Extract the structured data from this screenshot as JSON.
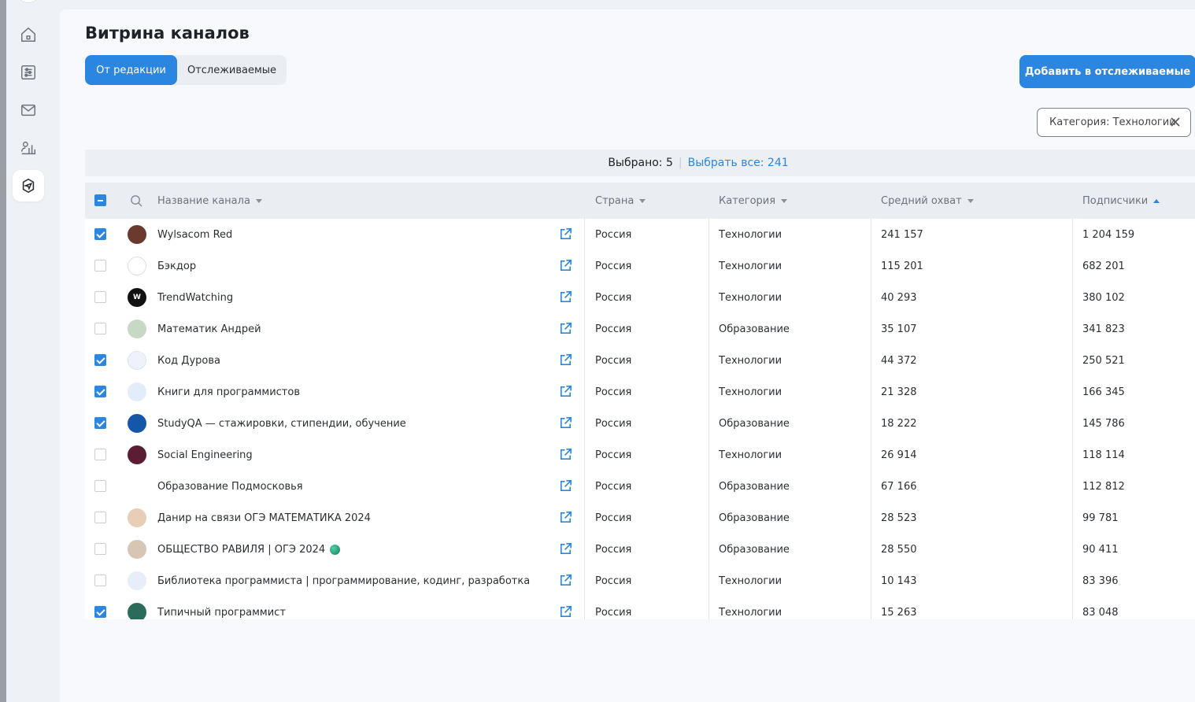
{
  "page": {
    "title": "Витрина каналов"
  },
  "tabs": [
    {
      "label": "От редакции",
      "active": true
    },
    {
      "label": "Отслеживаемые",
      "active": false
    }
  ],
  "actions": {
    "add_label": "Добавить в отслеживаемые"
  },
  "filter": {
    "label": "Категория: Технологии"
  },
  "selection": {
    "selected_text": "Выбрано: 5",
    "select_all_text": "Выбрать все: 241"
  },
  "nav": [
    "home-icon",
    "sliders-icon",
    "mail-icon",
    "analytics-icon",
    "channels-icon"
  ],
  "colors": {
    "accent": "#2a86e0",
    "background": "#f7f9fc"
  },
  "table": {
    "columns": [
      {
        "label": "Название канала",
        "sort": "down"
      },
      {
        "label": "Страна",
        "sort": "down"
      },
      {
        "label": "Категория",
        "sort": "down"
      },
      {
        "label": "Средний охват",
        "sort": "down"
      },
      {
        "label": "Подписчики",
        "sort": "up"
      }
    ],
    "rows": [
      {
        "checked": true,
        "name": "Wylsacom Red",
        "country": "Россия",
        "category": "Технологии",
        "reach": "241 157",
        "subscribers": "1 204 159"
      },
      {
        "checked": false,
        "name": "Бэкдор",
        "country": "Россия",
        "category": "Технологии",
        "reach": "115 201",
        "subscribers": "682 201"
      },
      {
        "checked": false,
        "name": "TrendWatching",
        "country": "Россия",
        "category": "Технологии",
        "reach": "40 293",
        "subscribers": "380 102"
      },
      {
        "checked": false,
        "name": "Математик Андрей",
        "country": "Россия",
        "category": "Образование",
        "reach": "35 107",
        "subscribers": "341 823"
      },
      {
        "checked": true,
        "name": "Код Дурова",
        "country": "Россия",
        "category": "Технологии",
        "reach": "44 372",
        "subscribers": "250 521"
      },
      {
        "checked": true,
        "name": "Книги для программистов",
        "country": "Россия",
        "category": "Технологии",
        "reach": "21 328",
        "subscribers": "166 345"
      },
      {
        "checked": true,
        "name": "StudyQA — стажировки, стипендии, обучение",
        "country": "Россия",
        "category": "Образование",
        "reach": "18 222",
        "subscribers": "145 786"
      },
      {
        "checked": false,
        "name": "Social Engineering",
        "country": "Россия",
        "category": "Технологии",
        "reach": "26 914",
        "subscribers": "118 114"
      },
      {
        "checked": false,
        "name": "Образование Подмосковья",
        "country": "Россия",
        "category": "Образование",
        "reach": "67 166",
        "subscribers": "112 812"
      },
      {
        "checked": false,
        "name": "Данир на связи ОГЭ МАТЕМАТИКА 2024",
        "country": "Россия",
        "category": "Образование",
        "reach": "28 523",
        "subscribers": "99 781"
      },
      {
        "checked": false,
        "name": "ОБЩЕСТВО РАВИЛЯ | ОГЭ 2024",
        "country": "Россия",
        "category": "Образование",
        "reach": "28 550",
        "subscribers": "90 411"
      },
      {
        "checked": false,
        "name": "Библиотека программиста | программирование, кодинг, разработка",
        "country": "Россия",
        "category": "Технологии",
        "reach": "10 143",
        "subscribers": "83 396"
      },
      {
        "checked": true,
        "name": "Типичный программист",
        "country": "Россия",
        "category": "Технологии",
        "reach": "15 263",
        "subscribers": "83 048"
      }
    ]
  }
}
